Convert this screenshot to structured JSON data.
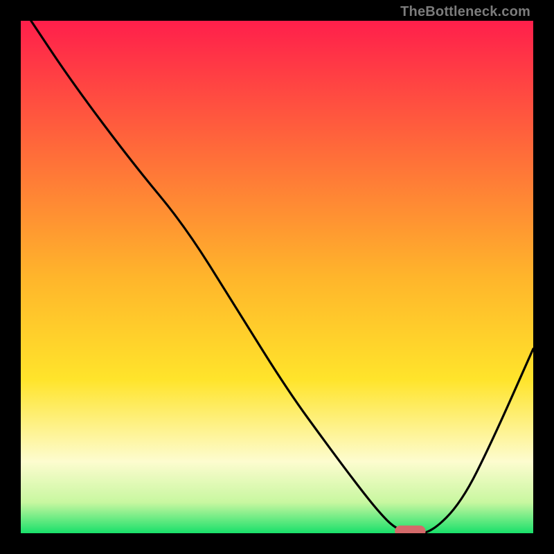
{
  "watermark": {
    "text": "TheBottleneck.com"
  },
  "chart_data": {
    "type": "line",
    "title": "",
    "xlabel": "",
    "ylabel": "",
    "xlim": [
      0,
      100
    ],
    "ylim": [
      0,
      100
    ],
    "grid": false,
    "legend": false,
    "background_gradient": {
      "stops": [
        {
          "offset": 0.0,
          "color": "#ff1f4b"
        },
        {
          "offset": 0.25,
          "color": "#ff6a3a"
        },
        {
          "offset": 0.5,
          "color": "#ffb52b"
        },
        {
          "offset": 0.7,
          "color": "#ffe42b"
        },
        {
          "offset": 0.86,
          "color": "#fdfccf"
        },
        {
          "offset": 0.94,
          "color": "#c8f7a0"
        },
        {
          "offset": 1.0,
          "color": "#18e06a"
        }
      ]
    },
    "series": [
      {
        "name": "bottleneck-curve",
        "color": "#000000",
        "x": [
          2,
          10,
          22,
          32,
          42,
          52,
          60,
          66,
          70,
          73,
          76,
          80,
          86,
          92,
          100
        ],
        "y": [
          100,
          88,
          72,
          60,
          44,
          28,
          17,
          9,
          4,
          1,
          0,
          0,
          6,
          18,
          36
        ]
      }
    ],
    "marker": {
      "name": "optimal-range",
      "color": "#d46a6a",
      "x_start": 73,
      "x_end": 79,
      "y": 0.4,
      "thickness": 2.2
    }
  }
}
